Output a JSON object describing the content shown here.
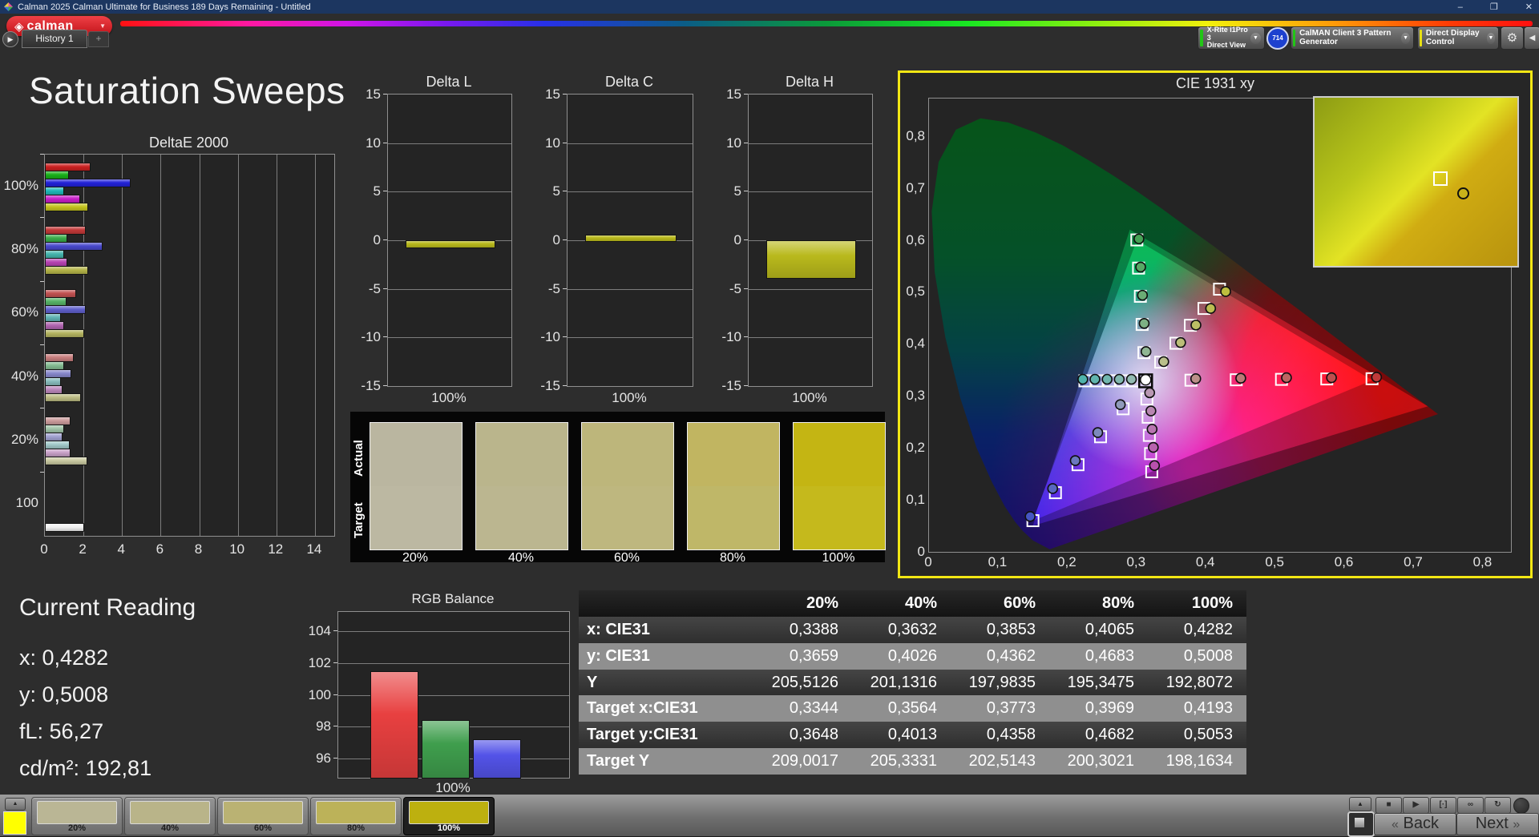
{
  "window": {
    "title": "Calman 2025 Calman Ultimate for Business 189 Days Remaining  - Untitled",
    "minimize": "–",
    "restore": "❐",
    "close": "✕"
  },
  "logo": {
    "word": "calman",
    "glyph": "◈",
    "dropdown": "▼"
  },
  "tabs": {
    "expand": "▶",
    "history": "History 1",
    "add": "+"
  },
  "toolbar": {
    "meter": {
      "line1": "X-Rite i1Pro 3",
      "line2": "Direct View",
      "accent": "#22c516",
      "badge": "714"
    },
    "pattern_generator": {
      "label": "CalMAN Client 3 Pattern Generator",
      "accent": "#22c516"
    },
    "display_control": {
      "label": "Direct Display Control",
      "accent": "#e8e013"
    },
    "gear": "⚙",
    "collapse": "◀",
    "arrow": "▼"
  },
  "page_title": "Saturation Sweeps",
  "chart_data": [
    {
      "id": "deltaE2000",
      "type": "bar",
      "orientation": "horizontal",
      "title": "DeltaE 2000",
      "xlabel": "",
      "ylabel": "",
      "xlim": [
        0,
        15
      ],
      "xticks": [
        0,
        2,
        4,
        6,
        8,
        10,
        12,
        14
      ],
      "grid": true,
      "series_names": [
        "red",
        "green",
        "blue",
        "cyan",
        "magenta",
        "yellow"
      ],
      "groups": [
        {
          "label": "100%",
          "values": [
            2.3,
            1.15,
            4.35,
            0.9,
            1.75,
            2.15
          ],
          "colors": [
            "#cc2020",
            "#18b018",
            "#2222d8",
            "#20b8b8",
            "#c81ec8",
            "#c4c41e"
          ]
        },
        {
          "label": "80%",
          "values": [
            2.05,
            1.1,
            2.9,
            0.9,
            1.1,
            2.15
          ],
          "colors": [
            "#c23838",
            "#3aac4a",
            "#4848cc",
            "#44b4ac",
            "#b844b4",
            "#b4b448"
          ]
        },
        {
          "label": "60%",
          "values": [
            1.55,
            1.05,
            2.05,
            0.75,
            0.9,
            1.95
          ],
          "colors": [
            "#c25252",
            "#58b468",
            "#6060cc",
            "#60b4b4",
            "#b065b0",
            "#b4b460"
          ]
        },
        {
          "label": "40%",
          "values": [
            1.4,
            0.9,
            1.3,
            0.75,
            0.85,
            1.8
          ],
          "colors": [
            "#c87e7e",
            "#84bc92",
            "#8888cc",
            "#88bcbc",
            "#bc88bc",
            "#bcbc84"
          ]
        },
        {
          "label": "20%",
          "values": [
            1.25,
            0.9,
            0.85,
            1.2,
            1.25,
            2.1
          ],
          "colors": [
            "#cc9c9c",
            "#a0c4a8",
            "#a0a0d0",
            "#a0c8c8",
            "#c8a0c8",
            "#c8c8a0"
          ]
        },
        {
          "label": "100",
          "values": [
            1.95
          ],
          "colors": [
            "#f2f2f2"
          ]
        }
      ]
    },
    {
      "id": "deltaL",
      "type": "bar",
      "title": "Delta L",
      "categories": [
        "100%"
      ],
      "values": [
        -0.7
      ],
      "ylim": [
        -15,
        15
      ],
      "yticks": [
        15,
        10,
        5,
        0,
        -5,
        -10,
        -15
      ],
      "color": "#b9b91c",
      "grid": true
    },
    {
      "id": "deltaC",
      "type": "bar",
      "title": "Delta C",
      "categories": [
        "100%"
      ],
      "values": [
        0.6
      ],
      "ylim": [
        -15,
        15
      ],
      "yticks": [
        15,
        10,
        5,
        0,
        -5,
        -10,
        -15
      ],
      "color": "#b9b91c",
      "grid": true
    },
    {
      "id": "deltaH",
      "type": "bar",
      "title": "Delta H",
      "categories": [
        "100%"
      ],
      "values": [
        -3.8
      ],
      "ylim": [
        -15,
        15
      ],
      "yticks": [
        15,
        10,
        5,
        0,
        -5,
        -10,
        -15
      ],
      "color": "#b9b91c",
      "grid": true
    },
    {
      "id": "rgb_balance",
      "type": "bar",
      "title": "RGB Balance",
      "categories": [
        "100%"
      ],
      "ylim": [
        94.8,
        105.2
      ],
      "yticks": [
        104,
        102,
        100,
        98,
        96
      ],
      "grid": true,
      "series": [
        {
          "name": "Red",
          "value": 101.5,
          "color": "#e84040"
        },
        {
          "name": "Green",
          "value": 98.4,
          "color": "#3f9e4d"
        },
        {
          "name": "Blue",
          "value": 97.2,
          "color": "#5353e8"
        }
      ]
    },
    {
      "id": "cie1931",
      "type": "scatter",
      "title": "CIE 1931 xy",
      "xlim": [
        0,
        0.84
      ],
      "ylim": [
        0,
        0.872
      ],
      "xtick_labels": [
        "0",
        "0,1",
        "0,2",
        "0,3",
        "0,4",
        "0,5",
        "0,6",
        "0,7",
        "0,8"
      ],
      "ytick_labels": [
        "0",
        "0,1",
        "0,2",
        "0,3",
        "0,4",
        "0,5",
        "0,6",
        "0,7",
        "0,8"
      ],
      "white_point": {
        "target": [
          0.3127,
          0.329
        ],
        "measured": [
          0.3127,
          0.331
        ]
      },
      "triangles": {
        "reference": [
          [
            0.64,
            0.33
          ],
          [
            0.3,
            0.6
          ],
          [
            0.15,
            0.06
          ]
        ],
        "native": [
          [
            0.72,
            0.28
          ],
          [
            0.29,
            0.62
          ],
          [
            0.15,
            0.05
          ]
        ]
      },
      "sweeps": [
        {
          "name": "red",
          "color": "#bf3a3a",
          "targets": [
            [
              0.3781,
              0.3302
            ],
            [
              0.4435,
              0.331
            ],
            [
              0.5088,
              0.3318
            ],
            [
              0.5742,
              0.3326
            ],
            [
              0.6395,
              0.333
            ]
          ],
          "measured": [
            [
              0.385,
              0.333
            ],
            [
              0.45,
              0.334
            ],
            [
              0.516,
              0.335
            ],
            [
              0.581,
              0.335
            ],
            [
              0.646,
              0.336
            ]
          ]
        },
        {
          "name": "green",
          "color": "#46a356",
          "targets": [
            [
              0.3102,
              0.3832
            ],
            [
              0.3076,
              0.4374
            ],
            [
              0.3051,
              0.4916
            ],
            [
              0.3025,
              0.5458
            ],
            [
              0.3,
              0.6
            ]
          ],
          "measured": [
            [
              0.3132,
              0.3852
            ],
            [
              0.3106,
              0.4394
            ],
            [
              0.3081,
              0.4936
            ],
            [
              0.3055,
              0.5478
            ],
            [
              0.303,
              0.602
            ]
          ]
        },
        {
          "name": "blue",
          "color": "#4656c2",
          "targets": [
            [
              0.2802,
              0.2752
            ],
            [
              0.2476,
              0.2214
            ],
            [
              0.2151,
              0.1676
            ],
            [
              0.1825,
              0.1138
            ],
            [
              0.15,
              0.06
            ]
          ],
          "measured": [
            [
              0.2762,
              0.2832
            ],
            [
              0.2436,
              0.2294
            ],
            [
              0.2111,
              0.1756
            ],
            [
              0.1785,
              0.1218
            ],
            [
              0.146,
              0.068
            ]
          ]
        },
        {
          "name": "cyan",
          "color": "#4fb3ab",
          "targets": [
            [
              0.2952,
              0.329
            ],
            [
              0.2776,
              0.329
            ],
            [
              0.2601,
              0.329
            ],
            [
              0.2425,
              0.329
            ],
            [
              0.225,
              0.329
            ]
          ],
          "measured": [
            [
              0.2922,
              0.332
            ],
            [
              0.2746,
              0.332
            ],
            [
              0.2571,
              0.332
            ],
            [
              0.2395,
              0.332
            ],
            [
              0.222,
              0.332
            ]
          ]
        },
        {
          "name": "magenta",
          "color": "#b851ad",
          "targets": [
            [
              0.3145,
              0.294
            ],
            [
              0.3163,
              0.259
            ],
            [
              0.318,
              0.224
            ],
            [
              0.3198,
              0.189
            ],
            [
              0.3215,
              0.154
            ]
          ],
          "measured": [
            [
              0.3185,
              0.306
            ],
            [
              0.3203,
              0.271
            ],
            [
              0.322,
              0.236
            ],
            [
              0.3238,
              0.201
            ],
            [
              0.3255,
              0.166
            ]
          ]
        },
        {
          "name": "yellow",
          "color": "#bdbd3e",
          "targets": [
            [
              0.3344,
              0.3648
            ],
            [
              0.3564,
              0.4013
            ],
            [
              0.3773,
              0.4358
            ],
            [
              0.3969,
              0.4682
            ],
            [
              0.4193,
              0.5053
            ]
          ],
          "measured": [
            [
              0.3388,
              0.3659
            ],
            [
              0.3632,
              0.4026
            ],
            [
              0.3853,
              0.4362
            ],
            [
              0.4065,
              0.4683
            ],
            [
              0.4282,
              0.5008
            ]
          ]
        }
      ]
    }
  ],
  "swatch_panel": {
    "row_labels": [
      "Actual",
      "Target"
    ],
    "items": [
      {
        "label": "20%",
        "actual": "#bab6a0",
        "target": "#bcb8a2"
      },
      {
        "label": "40%",
        "actual": "#bab58c",
        "target": "#bbb690"
      },
      {
        "label": "60%",
        "actual": "#bdb67b",
        "target": "#beb77f"
      },
      {
        "label": "80%",
        "actual": "#c1b561",
        "target": "#bfb768"
      },
      {
        "label": "100%",
        "actual": "#c4b513",
        "target": "#c5b91c"
      }
    ]
  },
  "current_reading": {
    "title": "Current Reading",
    "lines": [
      "x: 0,4282",
      "y: 0,5008",
      "fL: 56,27",
      "cd/m²: 192,81"
    ]
  },
  "table": {
    "columns": [
      "20%",
      "40%",
      "60%",
      "80%",
      "100%"
    ],
    "rows": [
      {
        "label": "x: CIE31",
        "shade": "dark",
        "values": [
          "0,3388",
          "0,3632",
          "0,3853",
          "0,4065",
          "0,4282"
        ]
      },
      {
        "label": "y: CIE31",
        "shade": "light",
        "values": [
          "0,3659",
          "0,4026",
          "0,4362",
          "0,4683",
          "0,5008"
        ]
      },
      {
        "label": "Y",
        "shade": "dark",
        "values": [
          "205,5126",
          "201,1316",
          "197,9835",
          "195,3475",
          "192,8072"
        ]
      },
      {
        "label": "Target x:CIE31",
        "shade": "light",
        "values": [
          "0,3344",
          "0,3564",
          "0,3773",
          "0,3969",
          "0,4193"
        ]
      },
      {
        "label": "Target y:CIE31",
        "shade": "dark",
        "values": [
          "0,3648",
          "0,4013",
          "0,4358",
          "0,4682",
          "0,5053"
        ]
      },
      {
        "label": "Target Y",
        "shade": "light",
        "values": [
          "209,0017",
          "205,3331",
          "202,5143",
          "200,3021",
          "198,1634"
        ]
      }
    ]
  },
  "bottom_bar": {
    "patch_color": "#ffff00",
    "buttons": [
      {
        "label": "20%",
        "color": "#bab695",
        "selected": false
      },
      {
        "label": "40%",
        "color": "#b9b489",
        "selected": false
      },
      {
        "label": "60%",
        "color": "#bab273",
        "selected": false
      },
      {
        "label": "80%",
        "color": "#bcb259",
        "selected": false
      },
      {
        "label": "100%",
        "color": "#bdb00f",
        "selected": true
      }
    ],
    "transport": [
      {
        "name": "stop",
        "glyph": "■"
      },
      {
        "name": "play",
        "glyph": "▶"
      },
      {
        "name": "single",
        "glyph": "[·]"
      },
      {
        "name": "continuous",
        "glyph": "∞"
      },
      {
        "name": "refresh",
        "glyph": "↻"
      }
    ],
    "back": "Back",
    "next": "Next",
    "back_chev": "«",
    "next_chev": "»",
    "up_arrow": "▲"
  }
}
